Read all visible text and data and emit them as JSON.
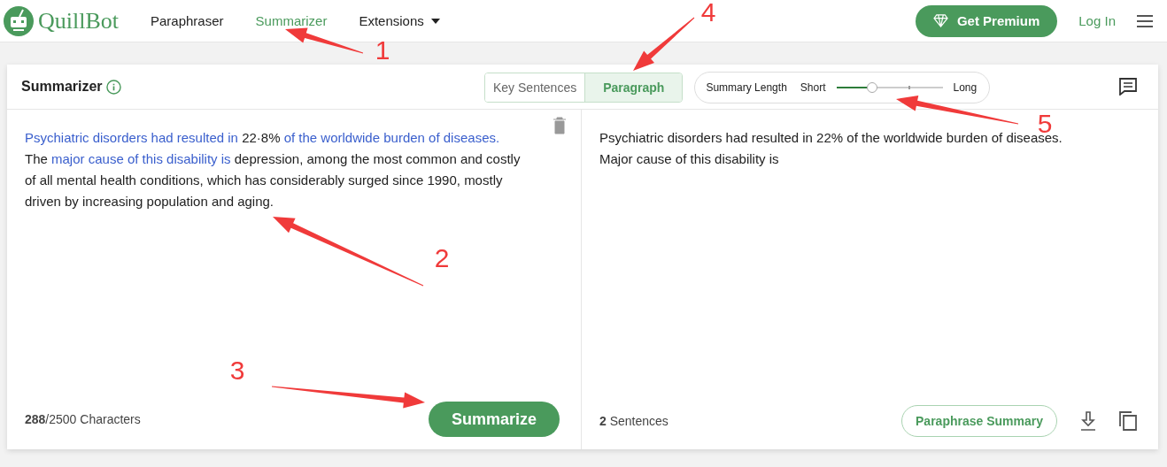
{
  "nav": {
    "brand": "QuillBot",
    "links": [
      {
        "label": "Paraphraser",
        "selected": false
      },
      {
        "label": "Summarizer",
        "selected": true
      },
      {
        "label": "Extensions",
        "dropdown": true
      }
    ],
    "premium": "Get Premium",
    "login": "Log In"
  },
  "tool": {
    "title": "Summarizer",
    "modes": [
      {
        "label": "Key Sentences",
        "selected": false
      },
      {
        "label": "Paragraph",
        "selected": true
      }
    ],
    "length": {
      "label": "Summary Length",
      "min": "Short",
      "max": "Long",
      "level": 0.34
    }
  },
  "input": {
    "segments": [
      {
        "text": "Psychiatric disorders had resulted in ",
        "highlighted": true
      },
      {
        "text": "22·8% ",
        "highlighted": false
      },
      {
        "text": "of the worldwide burden of diseases.",
        "highlighted": true
      },
      {
        "text": " The ",
        "highlighted": false
      },
      {
        "text": "major cause of this disability is",
        "highlighted": true
      },
      {
        "text": " depression, among the most common and costly of all mental health conditions, which has considerably surged since 1990, mostly driven by increasing population and aging.",
        "highlighted": false
      }
    ],
    "count": "**288**/2500 Characters",
    "button": "Summarize"
  },
  "output": {
    "text": "Psychiatric disorders had resulted in 22% of the worldwide burden of diseases. Major cause of this disability is",
    "count": "**2** Sentences",
    "button": "Paraphrase Summary"
  },
  "annotations": [
    {
      "label": "1"
    },
    {
      "label": "2"
    },
    {
      "label": "3"
    },
    {
      "label": "4"
    },
    {
      "label": "5"
    }
  ]
}
